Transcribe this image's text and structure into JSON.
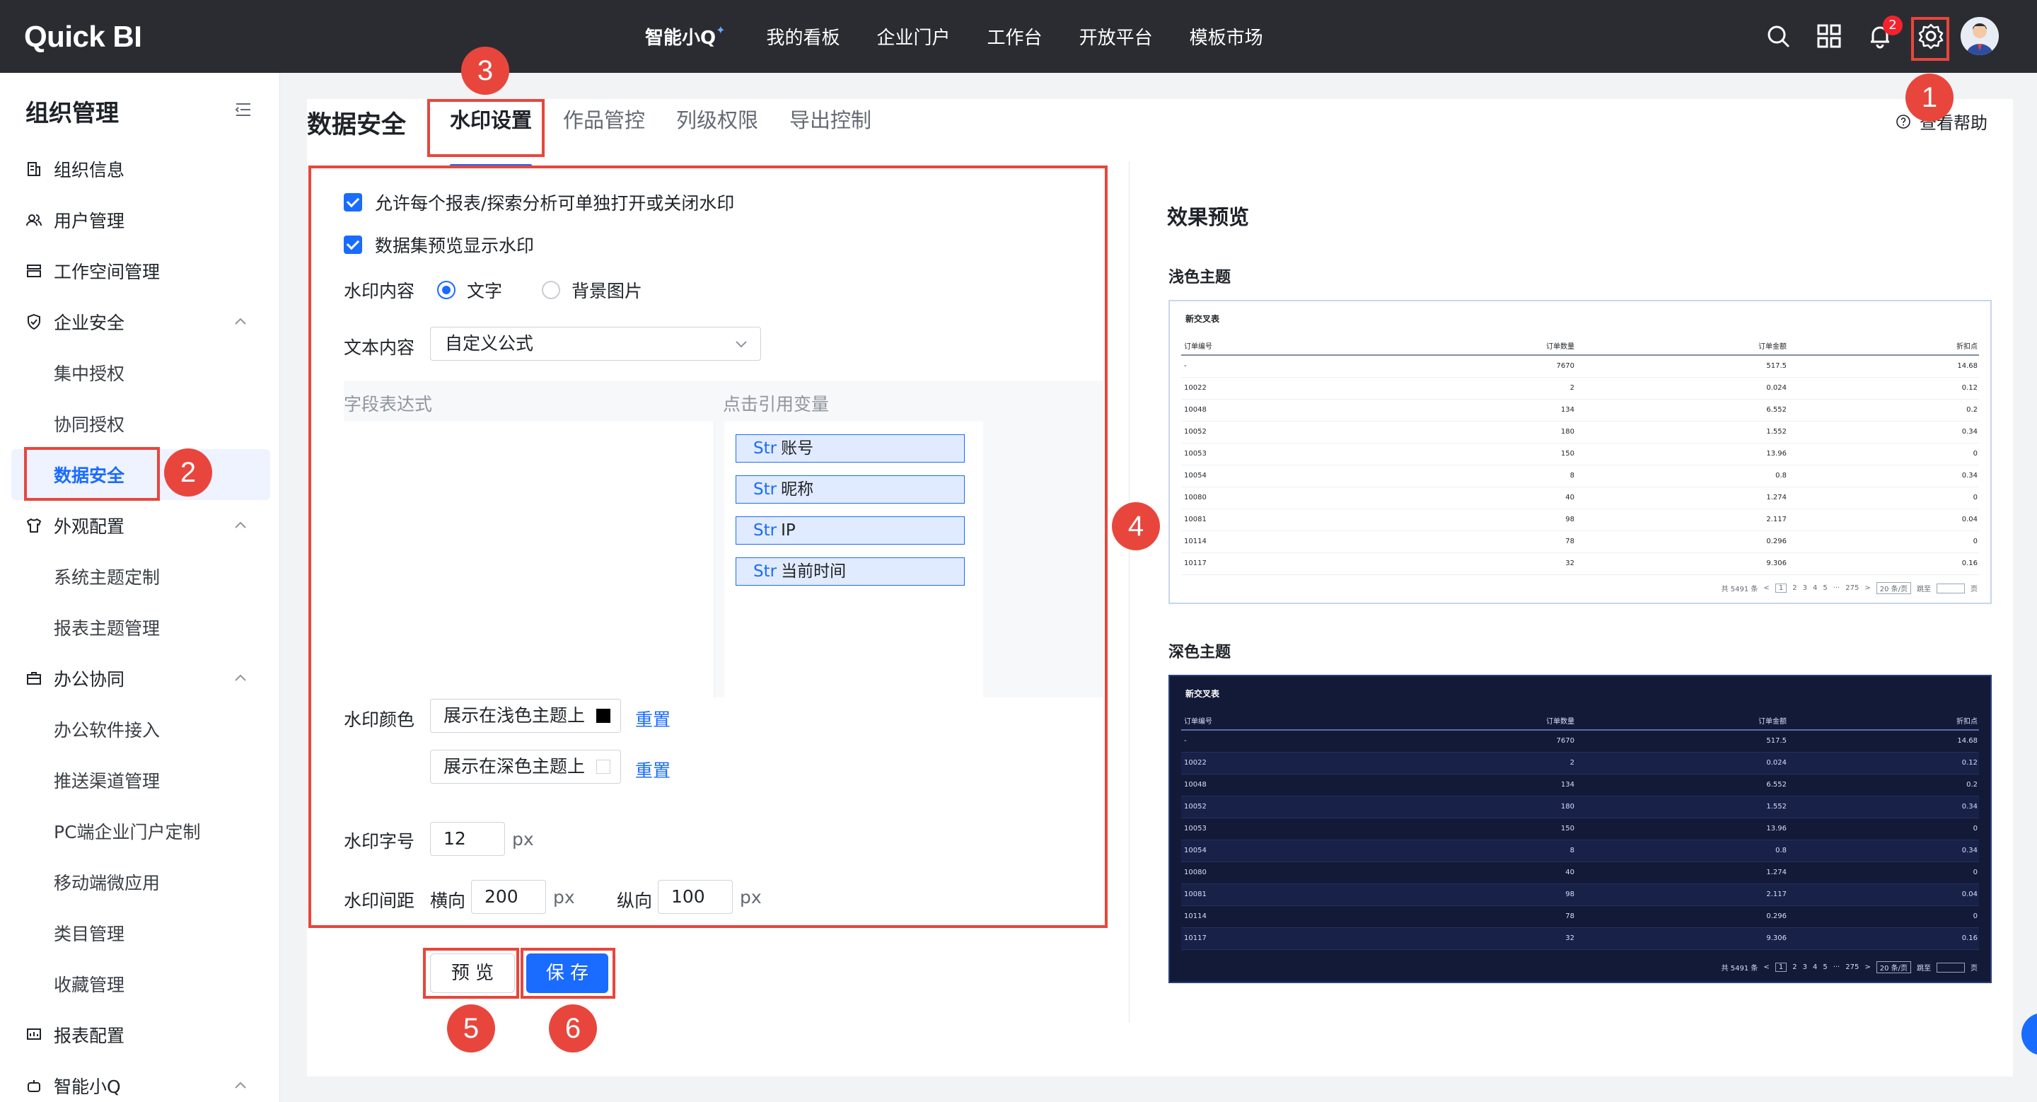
{
  "app": {
    "logo": "Quick BI"
  },
  "topnav": {
    "items": [
      "智能小Q",
      "我的看板",
      "企业门户",
      "工作台",
      "开放平台",
      "模板市场"
    ],
    "notification_count": "2"
  },
  "sidebar": {
    "title": "组织管理",
    "items": [
      {
        "label": "组织信息",
        "icon": "building-icon"
      },
      {
        "label": "用户管理",
        "icon": "users-icon"
      },
      {
        "label": "工作空间管理",
        "icon": "workspace-icon"
      },
      {
        "label": "企业安全",
        "icon": "shield-icon",
        "expanded": true
      },
      {
        "label": "集中授权"
      },
      {
        "label": "协同授权"
      },
      {
        "label": "数据安全",
        "active": true
      },
      {
        "label": "外观配置",
        "icon": "shirt-icon",
        "expanded": true
      },
      {
        "label": "系统主题定制"
      },
      {
        "label": "报表主题管理"
      },
      {
        "label": "办公协同",
        "icon": "briefcase-icon",
        "expanded": true
      },
      {
        "label": "办公软件接入"
      },
      {
        "label": "推送渠道管理"
      },
      {
        "label": "PC端企业门户定制"
      },
      {
        "label": "移动端微应用"
      },
      {
        "label": "类目管理"
      },
      {
        "label": "收藏管理"
      },
      {
        "label": "报表配置",
        "icon": "report-icon"
      },
      {
        "label": "智能小Q",
        "icon": "bot-icon"
      }
    ]
  },
  "page": {
    "title": "数据安全",
    "tabs": [
      "水印设置",
      "作品管控",
      "列级权限",
      "导出控制"
    ],
    "help": "查看帮助"
  },
  "form": {
    "check1": "允许每个报表/探索分析可单独打开或关闭水印",
    "check2": "数据集预览显示水印",
    "content_label": "水印内容",
    "radio_text": "文字",
    "radio_image": "背景图片",
    "text_content_label": "文本内容",
    "text_content_value": "自定义公式",
    "expr_label": "字段表达式",
    "vars_label": "点击引用变量",
    "vars": [
      {
        "type": "Str",
        "name": "账号"
      },
      {
        "type": "Str",
        "name": "昵称"
      },
      {
        "type": "Str",
        "name": "IP"
      },
      {
        "type": "Str",
        "name": "当前时间"
      }
    ],
    "color_label": "水印颜色",
    "color_light": "展示在浅色主题上",
    "color_dark": "展示在深色主题上",
    "reset": "重置",
    "size_label": "水印字号",
    "size_value": "12",
    "px": "px",
    "spacing_label": "水印间距",
    "horizontal_label": "横向",
    "horizontal_value": "200",
    "vertical_label": "纵向",
    "vertical_value": "100",
    "preview_btn": "预 览",
    "save_btn": "保 存"
  },
  "preview": {
    "title": "效果预览",
    "light_label": "浅色主题",
    "dark_label": "深色主题",
    "table_title": "新交叉表",
    "columns": [
      "订单编号",
      "订单数量",
      "订单金额",
      "折扣点"
    ],
    "rows": [
      [
        "-",
        "7670",
        "517.5",
        "14.68"
      ],
      [
        "10022",
        "2",
        "0.024",
        "0.12"
      ],
      [
        "10048",
        "134",
        "6.552",
        "0.2"
      ],
      [
        "10052",
        "180",
        "1.552",
        "0.34"
      ],
      [
        "10053",
        "150",
        "13.96",
        "0"
      ],
      [
        "10054",
        "8",
        "0.8",
        "0.34"
      ],
      [
        "10080",
        "40",
        "1.274",
        "0"
      ],
      [
        "10081",
        "98",
        "2.117",
        "0.04"
      ],
      [
        "10114",
        "78",
        "0.296",
        "0"
      ],
      [
        "10117",
        "32",
        "9.306",
        "0.16"
      ]
    ],
    "pager": {
      "total": "共 5491 条",
      "pages": [
        "1",
        "2",
        "3",
        "4",
        "5",
        "···",
        "275"
      ],
      "page_size": "20 条/页",
      "jump": "跳至",
      "page_unit": "页"
    }
  },
  "annotations": [
    "1",
    "2",
    "3",
    "4",
    "5",
    "6"
  ],
  "colors": {
    "accent": "#1a6bff",
    "annotation": "#e8463c",
    "topbar": "#2b2c31",
    "dark_table": "#121a38"
  }
}
